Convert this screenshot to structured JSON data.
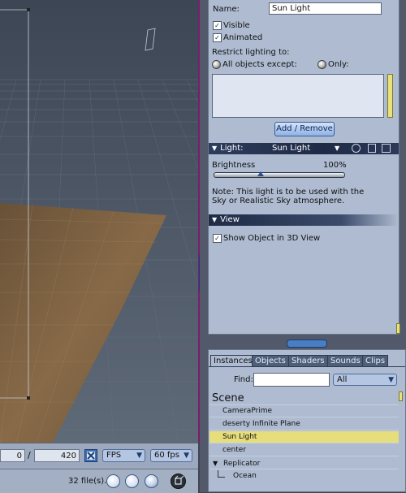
{
  "viewport": {
    "label": "3D viewport"
  },
  "timeline": {
    "frame_current": "0",
    "separator": "/",
    "frame_end": "420",
    "unit_select": "FPS",
    "rate_select": "60 fps"
  },
  "statusbar": {
    "file_count": "32 file(s)."
  },
  "properties": {
    "name_label": "Name:",
    "name_value": "Sun Light",
    "visible_label": "Visible",
    "animated_label": "Animated",
    "restrict_label": "Restrict lighting to:",
    "option_all_except": "All objects except:",
    "option_only": "Only:",
    "add_remove_button": "Add / Remove",
    "light_section": {
      "label": "Light:",
      "light_type": "Sun Light",
      "brightness_label": "Brightness",
      "brightness_value": "100%",
      "note_line1": "Note: This light is to be used with the",
      "note_line2": "Sky or Realistic Sky atmosphere."
    },
    "view_section": {
      "label": "View",
      "show_object_label": "Show Object in 3D View"
    }
  },
  "browser": {
    "tabs": [
      "Instances",
      "Objects",
      "Shaders",
      "Sounds",
      "Clips"
    ],
    "find_label": "Find:",
    "find_value": "",
    "filter_select": "All",
    "scene_header": "Scene",
    "items": [
      {
        "label": "CameraPrime"
      },
      {
        "label": "deserty Infinite Plane"
      },
      {
        "label": "Sun Light"
      },
      {
        "label": "center"
      },
      {
        "label": "Replicator"
      },
      {
        "label": "Ocean"
      }
    ]
  },
  "colors": {
    "selection": "#e6dd7c",
    "accent_blue": "#4a7ec2",
    "section_header": "#1e2a45",
    "magenta_border": "#7a1e6e"
  }
}
